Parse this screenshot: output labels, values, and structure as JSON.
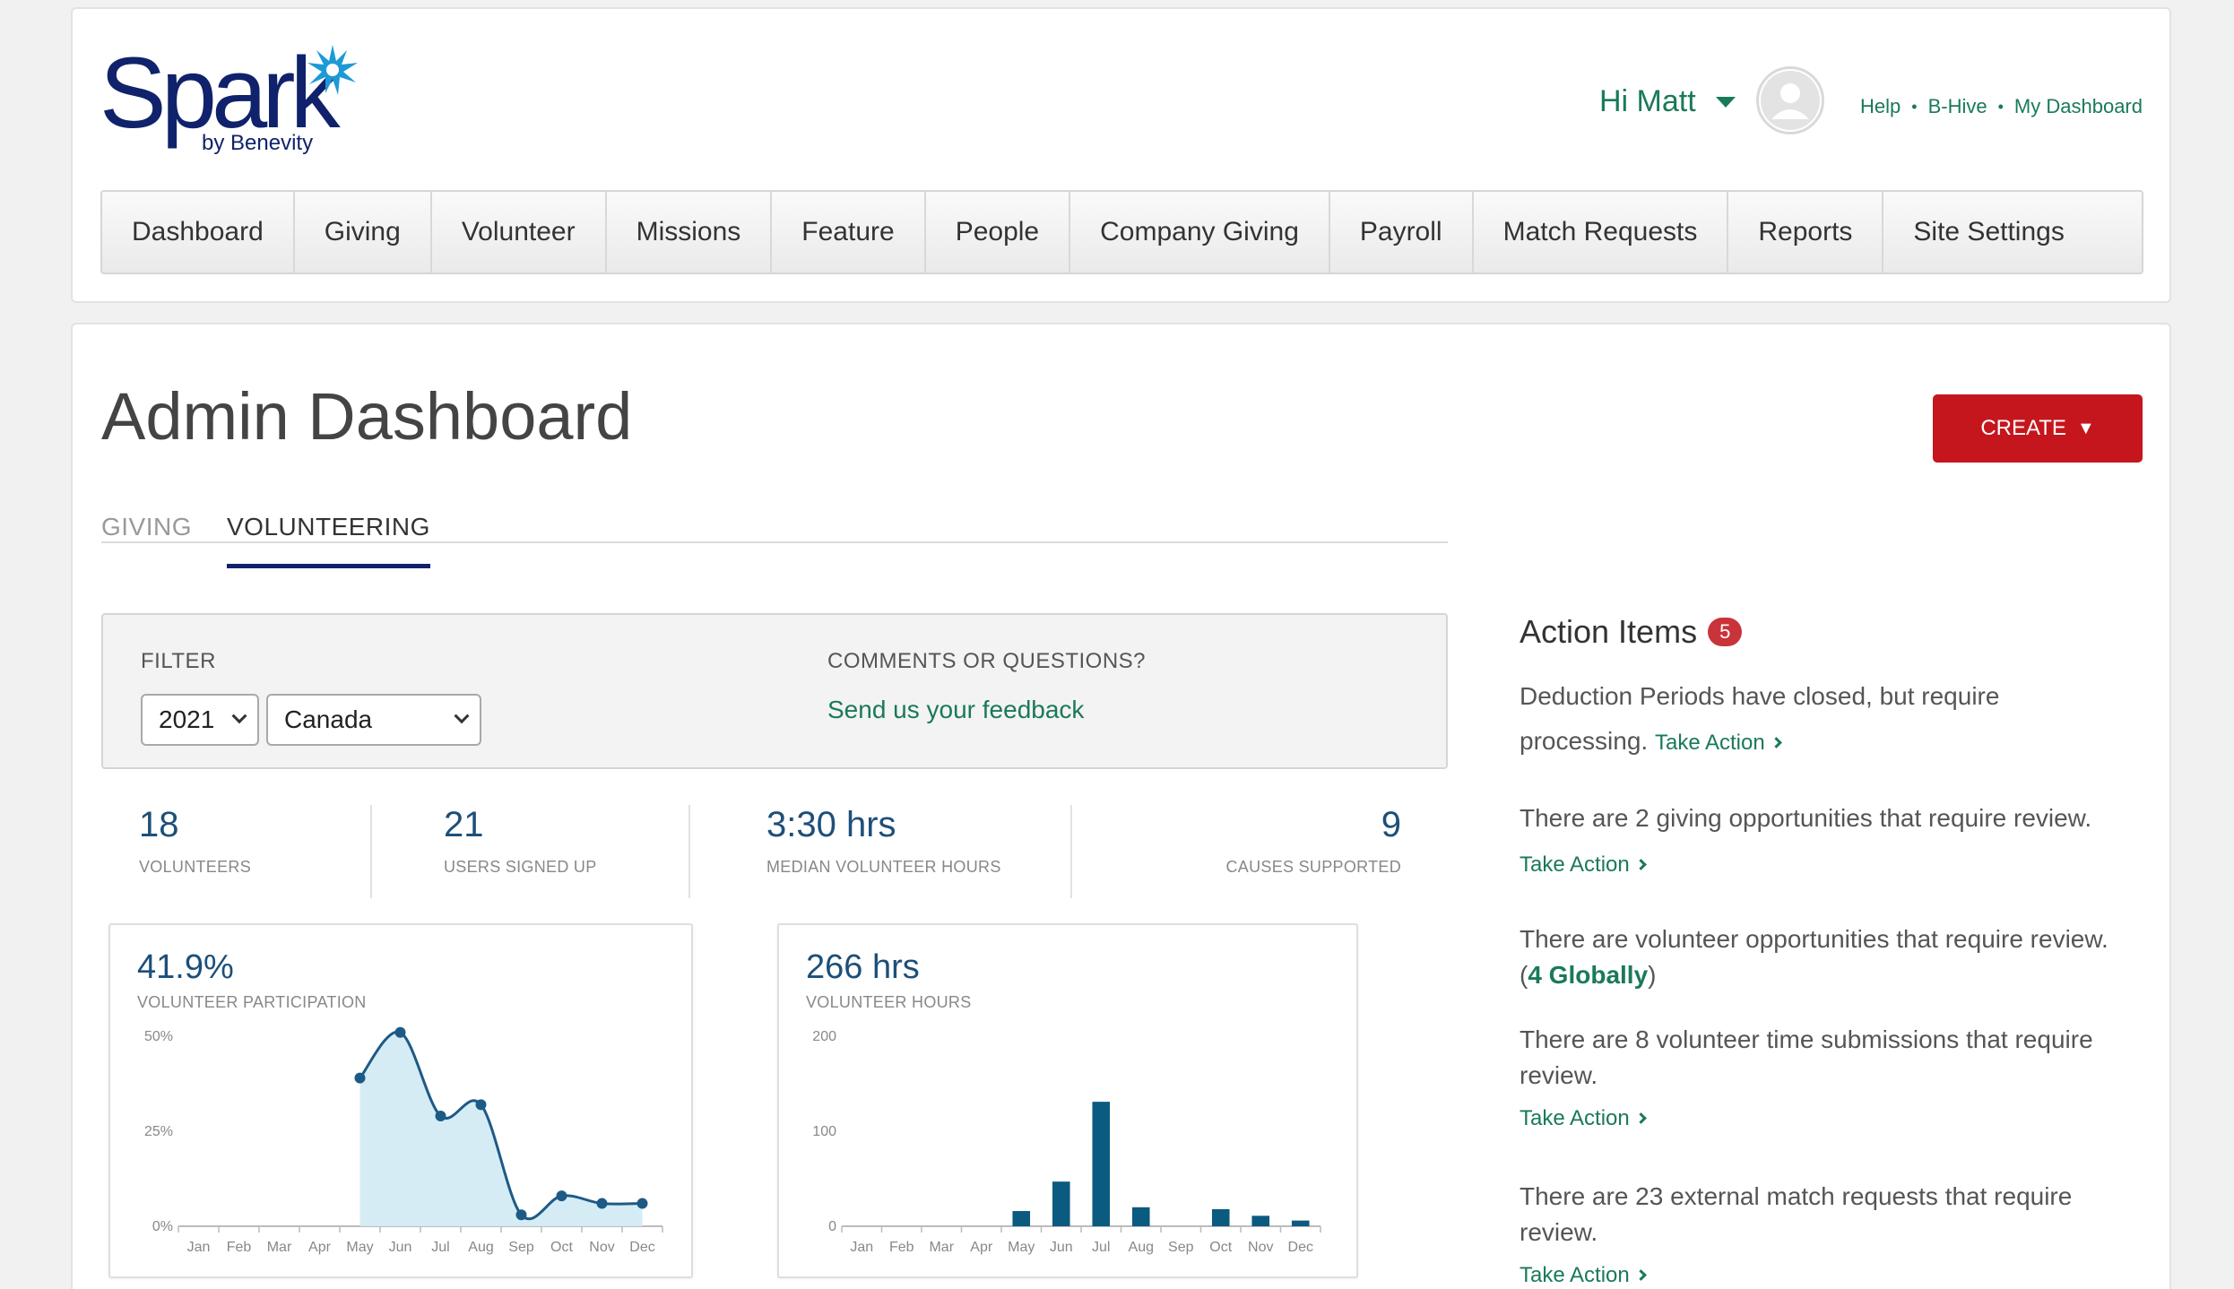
{
  "brand": {
    "name": "Spark",
    "sub": "by Benevity"
  },
  "user": {
    "greeting": "Hi Matt"
  },
  "top_links": [
    "Help",
    "B-Hive",
    "My Dashboard"
  ],
  "nav": [
    "Dashboard",
    "Giving",
    "Volunteer",
    "Missions",
    "Feature",
    "People",
    "Company Giving",
    "Payroll",
    "Match Requests",
    "Reports",
    "Site Settings"
  ],
  "page": {
    "title": "Admin Dashboard",
    "create_label": "CREATE"
  },
  "tabs": {
    "giving": "GIVING",
    "volunteering": "VOLUNTEERING",
    "active": "VOLUNTEERING"
  },
  "filter": {
    "label": "FILTER",
    "year": "2021",
    "country": "Canada"
  },
  "comments": {
    "label": "COMMENTS OR QUESTIONS?",
    "link": "Send us your feedback"
  },
  "stats": [
    {
      "value": "18",
      "label": "VOLUNTEERS"
    },
    {
      "value": "21",
      "label": "USERS SIGNED UP"
    },
    {
      "value": "3:30 hrs",
      "label": "MEDIAN VOLUNTEER HOURS"
    },
    {
      "value": "9",
      "label": "CAUSES SUPPORTED"
    }
  ],
  "participation": {
    "big": "41.9%",
    "label": "VOLUNTEER PARTICIPATION"
  },
  "hours": {
    "big": "266 hrs",
    "label": "VOLUNTEER HOURS"
  },
  "chart_data": [
    {
      "type": "area",
      "title": "41.9%",
      "subtitle": "VOLUNTEER PARTICIPATION",
      "categories": [
        "Jan",
        "Feb",
        "Mar",
        "Apr",
        "May",
        "Jun",
        "Jul",
        "Aug",
        "Sep",
        "Oct",
        "Nov",
        "Dec"
      ],
      "y_ticks": [
        "0%",
        "25%",
        "50%"
      ],
      "ylim": [
        0,
        50
      ],
      "values": [
        null,
        null,
        null,
        null,
        39,
        51,
        29,
        32,
        3,
        8,
        6,
        6
      ],
      "color": "#1d5a86",
      "fill": "#d5ecf4"
    },
    {
      "type": "bar",
      "title": "266 hrs",
      "subtitle": "VOLUNTEER HOURS",
      "categories": [
        "Jan",
        "Feb",
        "Mar",
        "Apr",
        "May",
        "Jun",
        "Jul",
        "Aug",
        "Sep",
        "Oct",
        "Nov",
        "Dec"
      ],
      "y_ticks": [
        "0",
        "100",
        "200"
      ],
      "ylim": [
        0,
        200
      ],
      "values": [
        0,
        0,
        0,
        0,
        16,
        47,
        131,
        20,
        0,
        18,
        11,
        6
      ],
      "color": "#0b5a80"
    }
  ],
  "action_items": {
    "title": "Action Items",
    "count": "5",
    "take_action": "Take Action",
    "item1": "Deduction Periods have closed, but require processing.",
    "item2": "There are 2 giving opportunities that require review.",
    "item3_pre": "There are volunteer opportunities that require review. (",
    "item3_link": "4 Globally",
    "item3_post": ")",
    "item4": "There are 8 volunteer time submissions that require review.",
    "item5": "There are 23 external match requests that require review."
  },
  "colors": {
    "brand": "#10226b",
    "accent": "#1a7a57",
    "create": "#c5161d"
  }
}
